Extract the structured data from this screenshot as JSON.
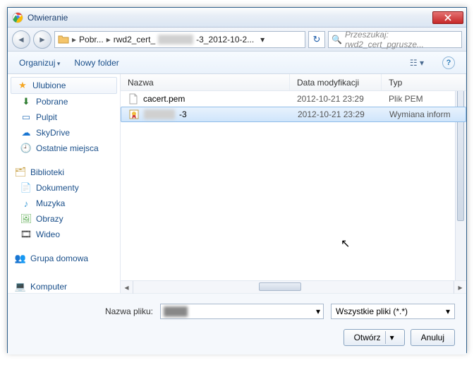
{
  "title": "Otwieranie",
  "breadcrumbs": {
    "a": "Pobr...",
    "b": "rwd2_cert_",
    "c": "-3_2012-10-2..."
  },
  "search_placeholder": "Przeszukaj: rwd2_cert_pgrusze...",
  "toolbar": {
    "organize": "Organizuj",
    "newfolder": "Nowy folder"
  },
  "sidebar": {
    "fav": "Ulubione",
    "fav_items": [
      "Pobrane",
      "Pulpit",
      "SkyDrive",
      "Ostatnie miejsca"
    ],
    "lib": "Biblioteki",
    "lib_items": [
      "Dokumenty",
      "Muzyka",
      "Obrazy",
      "Wideo"
    ],
    "home": "Grupa domowa",
    "comp": "Komputer"
  },
  "columns": {
    "name": "Nazwa",
    "date": "Data modyfikacji",
    "type": "Typ"
  },
  "files": [
    {
      "name": "cacert.pem",
      "date": "2012-10-21 23:29",
      "type": "Plik PEM",
      "icon": "file",
      "selected": false
    },
    {
      "name": "████-3",
      "date": "2012-10-21 23:29",
      "type": "Wymiana inform",
      "icon": "cert",
      "selected": true,
      "blur": true
    }
  ],
  "bottom": {
    "fname_label": "Nazwa pliku:",
    "fname_value": "████",
    "filter": "Wszystkie pliki (*.*)",
    "open": "Otwórz",
    "cancel": "Anuluj"
  }
}
